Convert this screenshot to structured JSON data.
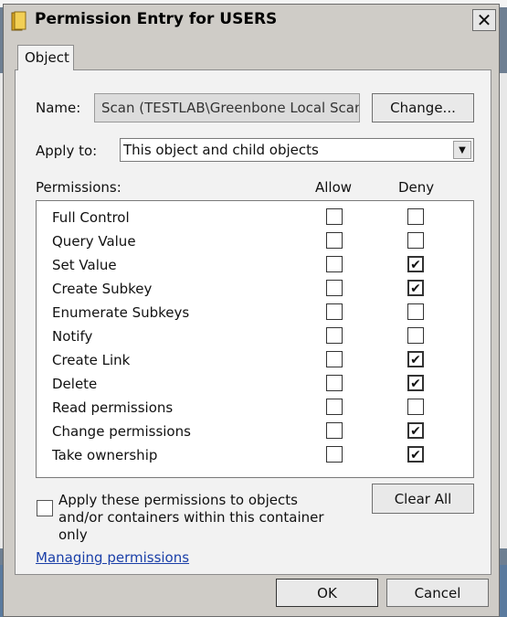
{
  "window": {
    "title": "Permission Entry for USERS"
  },
  "tabs": [
    {
      "label": "Object"
    }
  ],
  "name_label": "Name:",
  "name_value": "Scan (TESTLAB\\Greenbone Local Scan)",
  "change_label": "Change...",
  "apply_to_label": "Apply to:",
  "apply_to_value": "This object and child objects",
  "permissions_header": {
    "label": "Permissions:",
    "allow": "Allow",
    "deny": "Deny"
  },
  "permissions": [
    {
      "name": "Full Control",
      "allow": false,
      "deny": false
    },
    {
      "name": "Query Value",
      "allow": false,
      "deny": false
    },
    {
      "name": "Set Value",
      "allow": false,
      "deny": true
    },
    {
      "name": "Create Subkey",
      "allow": false,
      "deny": true
    },
    {
      "name": "Enumerate Subkeys",
      "allow": false,
      "deny": false
    },
    {
      "name": "Notify",
      "allow": false,
      "deny": false
    },
    {
      "name": "Create Link",
      "allow": false,
      "deny": true
    },
    {
      "name": "Delete",
      "allow": false,
      "deny": true
    },
    {
      "name": "Read permissions",
      "allow": false,
      "deny": false
    },
    {
      "name": "Change permissions",
      "allow": false,
      "deny": true
    },
    {
      "name": "Take ownership",
      "allow": false,
      "deny": true
    }
  ],
  "apply_container_text": "Apply these permissions to objects and/or containers within this container only",
  "apply_container_checked": false,
  "clear_all_label": "Clear All",
  "managing_link": "Managing permissions",
  "ok_label": "OK",
  "cancel_label": "Cancel",
  "close_glyph": "✕"
}
